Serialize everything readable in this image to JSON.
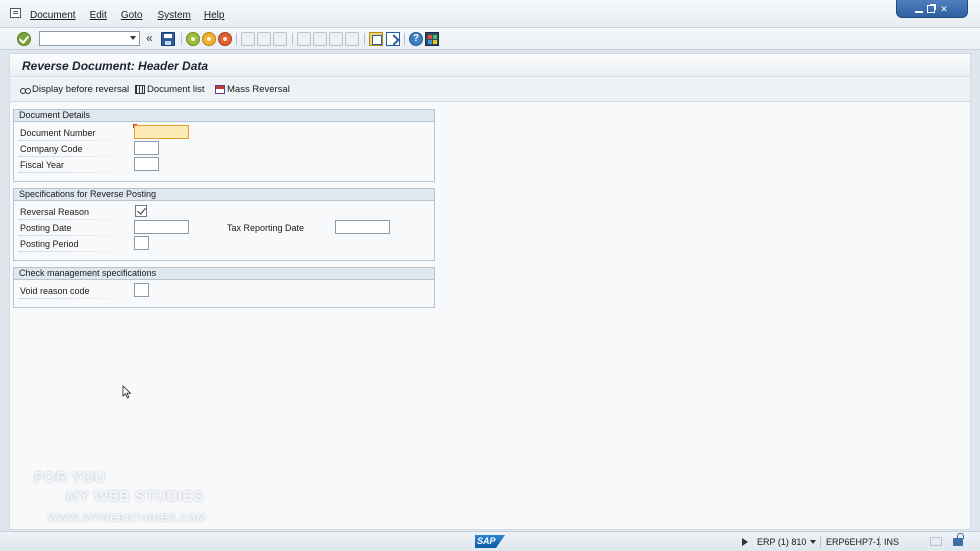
{
  "menu": {
    "items": [
      "Document",
      "Edit",
      "Goto",
      "System",
      "Help"
    ]
  },
  "window_controls": {
    "minimize": "_",
    "restore": "❐",
    "close": "✕"
  },
  "toolbar": {
    "command_field_value": "",
    "back_double_chevron": "«",
    "icons": [
      "ok-icon",
      "save-icon",
      "back-icon",
      "exit-icon",
      "cancel-icon",
      "print-icon",
      "find-icon",
      "find-next-icon",
      "first-page-icon",
      "previous-page-icon",
      "next-page-icon",
      "last-page-icon",
      "create-session-icon",
      "shortcut-icon",
      "help-icon",
      "layout-icon"
    ],
    "help_glyph": "?"
  },
  "page": {
    "title": "Reverse Document: Header Data"
  },
  "app_toolbar": {
    "display_before_reversal": "Display before reversal",
    "document_list": "Document list",
    "mass_reversal": "Mass Reversal"
  },
  "groups": {
    "document_details": {
      "heading": "Document Details",
      "document_number_label": "Document Number",
      "document_number_value": "",
      "company_code_label": "Company Code",
      "company_code_value": "",
      "fiscal_year_label": "Fiscal Year",
      "fiscal_year_value": ""
    },
    "reverse_posting": {
      "heading": "Specifications for Reverse Posting",
      "reversal_reason_label": "Reversal Reason",
      "reversal_reason_checked": true,
      "posting_date_label": "Posting Date",
      "posting_date_value": "",
      "tax_reporting_date_label": "Tax Reporting Date",
      "tax_reporting_date_value": "",
      "posting_period_label": "Posting Period",
      "posting_period_value": ""
    },
    "check_management": {
      "heading": "Check management specifications",
      "void_reason_code_label": "Void reason code",
      "void_reason_code_value": ""
    }
  },
  "watermark": {
    "line1": "FOR YOU",
    "line2": "MY WEB STUDIES",
    "line3": "WWW.MYWEBSTUDIES.COM"
  },
  "status_bar": {
    "logo_text": "SAP",
    "system": "ERP (1) 810",
    "server": "ERP6EHP7-1",
    "mode": "INS"
  },
  "colors": {
    "focus_field": "#fcebb5",
    "group_header": "#dfe7ef",
    "window_controls": "#3d6fb0"
  }
}
